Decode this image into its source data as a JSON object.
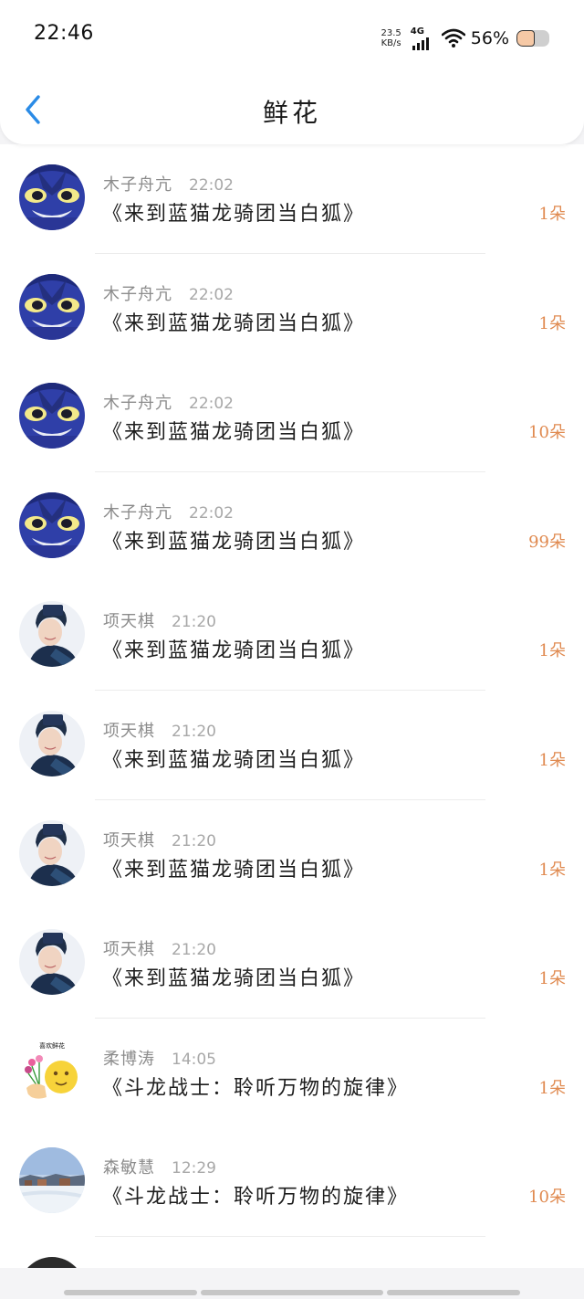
{
  "status": {
    "time": "22:46",
    "net_speed_value": "23.5",
    "net_speed_unit": "KB/s",
    "network": "4G",
    "battery": "56%"
  },
  "nav": {
    "title": "鲜花",
    "back_icon": "chevron-left-icon"
  },
  "colors": {
    "accent": "#2a8be6",
    "count": "#e08a50",
    "meta": "#8c8c8c"
  },
  "items": [
    {
      "name": "木子舟亢",
      "time": "22:02",
      "title": "《来到蓝猫龙骑团当白狐》",
      "count": "1朵",
      "avatar": "blue-monster"
    },
    {
      "name": "木子舟亢",
      "time": "22:02",
      "title": "《来到蓝猫龙骑团当白狐》",
      "count": "1朵",
      "avatar": "blue-monster"
    },
    {
      "name": "木子舟亢",
      "time": "22:02",
      "title": "《来到蓝猫龙骑团当白狐》",
      "count": "10朵",
      "avatar": "blue-monster"
    },
    {
      "name": "木子舟亢",
      "time": "22:02",
      "title": "《来到蓝猫龙骑团当白狐》",
      "count": "99朵",
      "avatar": "blue-monster"
    },
    {
      "name": "项天棋",
      "time": "21:20",
      "title": "《来到蓝猫龙骑团当白狐》",
      "count": "1朵",
      "avatar": "person"
    },
    {
      "name": "项天棋",
      "time": "21:20",
      "title": "《来到蓝猫龙骑团当白狐》",
      "count": "1朵",
      "avatar": "person"
    },
    {
      "name": "项天棋",
      "time": "21:20",
      "title": "《来到蓝猫龙骑团当白狐》",
      "count": "1朵",
      "avatar": "person"
    },
    {
      "name": "项天棋",
      "time": "21:20",
      "title": "《来到蓝猫龙骑团当白狐》",
      "count": "1朵",
      "avatar": "person"
    },
    {
      "name": "柔博涛",
      "time": "14:05",
      "title": "《斗龙战士：聆听万物的旋律》",
      "count": "1朵",
      "avatar": "flower-emoji",
      "avatar_caption": "喜欢鲜花"
    },
    {
      "name": "森敏慧",
      "time": "12:29",
      "title": "《斗龙战士：聆听万物的旋律》",
      "count": "10朵",
      "avatar": "winter-landscape"
    }
  ]
}
